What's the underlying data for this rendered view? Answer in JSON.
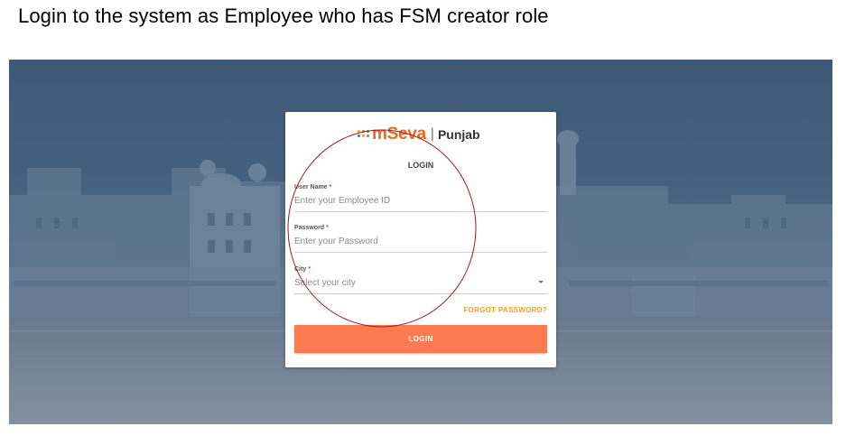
{
  "instruction": "Login to the system as Employee who has FSM creator role",
  "brand": {
    "name": "mSeva",
    "separator": "|",
    "state": "Punjab",
    "accent_color": "#e26a21"
  },
  "login_card": {
    "title": "LOGIN",
    "username": {
      "label": "User Name",
      "required_mark": "*",
      "placeholder": "Enter your Employee ID"
    },
    "password": {
      "label": "Password",
      "required_mark": "*",
      "placeholder": "Enter your Password"
    },
    "city": {
      "label": "City",
      "required_mark": "*",
      "placeholder": "Select your city"
    },
    "forgot_password": "FORGOT PASSWORD?",
    "login_button": "LOGIN",
    "button_color": "#fe7a51",
    "forgot_color": "#f3a125"
  },
  "annotation": {
    "shape": "circle",
    "color": "#a01818"
  },
  "icons": {
    "dropdown": "chevron-down-icon",
    "logo": "mseva-logo-icon"
  }
}
